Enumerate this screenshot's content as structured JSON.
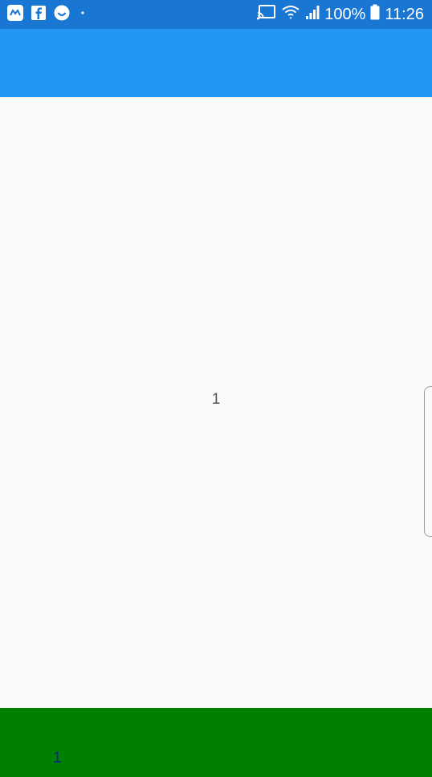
{
  "status_bar": {
    "battery_percent": "100%",
    "time": "11:26",
    "background": "#1976d2",
    "icons_left": [
      "messenger-lite-icon",
      "facebook-icon",
      "smiley-app-icon",
      "more-notifications-dot-icon"
    ],
    "icons_right": [
      "cast-icon",
      "wifi-icon",
      "signal-icon",
      "battery-icon"
    ]
  },
  "app_bar": {
    "background": "#2196f3"
  },
  "main": {
    "center_text": "1"
  },
  "bottom_bar": {
    "background": "#008000",
    "text": "1"
  }
}
